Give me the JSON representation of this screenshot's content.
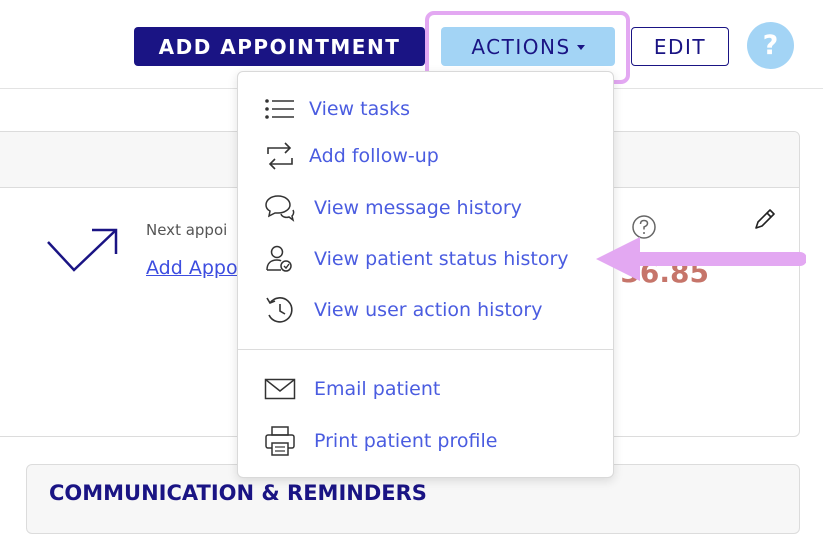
{
  "toolbar": {
    "add_appointment": "ADD APPOINTMENT",
    "actions": "ACTIONS",
    "edit": "EDIT",
    "help": "?"
  },
  "appointment": {
    "next_label": "Next appoi",
    "add_link": "Add Appo",
    "amount": ", 36.85"
  },
  "communication": {
    "title": "COMMUNICATION & REMINDERS"
  },
  "menu": {
    "items": [
      {
        "label": "View tasks",
        "icon": "list-icon"
      },
      {
        "label": "Add follow-up",
        "icon": "repeat-icon"
      },
      {
        "label": "View message history",
        "icon": "chat-bubbles-icon"
      },
      {
        "label": "View patient status history",
        "icon": "user-status-icon"
      },
      {
        "label": "View user action history",
        "icon": "history-icon"
      },
      {
        "label": "Email patient",
        "icon": "envelope-icon"
      },
      {
        "label": "Print patient profile",
        "icon": "printer-icon"
      }
    ]
  },
  "colors": {
    "primary": "#1a1484",
    "accent": "#a3d4f5",
    "link": "#4a5ce0",
    "highlight": "#e3a8f2",
    "amount": "#c6756a"
  }
}
